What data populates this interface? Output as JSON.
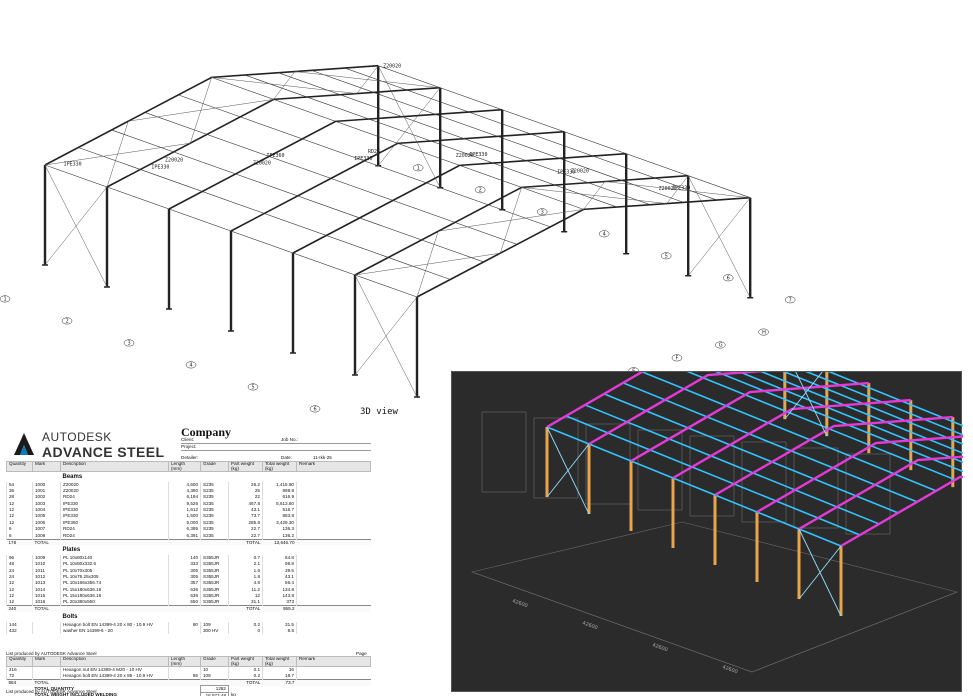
{
  "drawing": {
    "view_label": "3D view",
    "member_labels": [
      "IPE330",
      "Z20020",
      "IPE360",
      "RD24",
      "IPE330",
      "Z20020",
      "IPE330",
      "Z20020",
      "IPE330",
      "Z20020",
      "IPE330",
      "Z20020",
      "IPE330",
      "Z20020"
    ],
    "grid_markers": [
      "1",
      "2",
      "3",
      "4",
      "5",
      "6",
      "7",
      "A",
      "B",
      "C",
      "D",
      "E",
      "F",
      "G",
      "H",
      "1",
      "2",
      "3",
      "4",
      "5",
      "6",
      "7"
    ]
  },
  "bom": {
    "brand_line1": "AUTODESK",
    "brand_line2": "ADVANCE STEEL",
    "company": "Company",
    "client_label": "Client:",
    "job_label": "Job No.:",
    "project_label": "Project:",
    "detailer_label": "Detailer:",
    "date_label": "Date:",
    "date_value": "11-Ikk-25",
    "columns": [
      "Quantity",
      "Mark",
      "Description",
      "Length\n(mm)",
      "Grade",
      "Part weight\n(kg)",
      "Total weight\n(kg)",
      "Remark"
    ],
    "sections": [
      {
        "title": "Beams",
        "rows": [
          [
            "54",
            "1000",
            "Z20020",
            "4,600",
            "S235",
            "26.2",
            "1,415.90",
            ""
          ],
          [
            "36",
            "1001",
            "Z20020",
            "4,380",
            "S235",
            "25",
            "898.8",
            ""
          ],
          [
            "28",
            "1002",
            "RD24",
            "6,194",
            "S235",
            "22",
            "616.9",
            ""
          ],
          [
            "12",
            "1003",
            "IPE330",
            "9,526",
            "S235",
            "467.8",
            "5,613.60",
            ""
          ],
          [
            "12",
            "1004",
            "IPE330",
            "1,612",
            "S235",
            "43.1",
            "516.7",
            ""
          ],
          [
            "12",
            "1005",
            "IPE330",
            "1,500",
            "S235",
            "73.7",
            "883.8",
            ""
          ],
          [
            "12",
            "1006",
            "IPE360",
            "5,000",
            "S235",
            "285.8",
            "3,429.30",
            ""
          ],
          [
            "6",
            "1007",
            "RD24",
            "6,395",
            "S235",
            "22.7",
            "136.3",
            ""
          ],
          [
            "6",
            "1008",
            "RD24",
            "6,391",
            "S235",
            "22.7",
            "136.2",
            ""
          ]
        ],
        "total": [
          "178",
          "TOTAL",
          "",
          "",
          "",
          "TOTAL",
          "13,646.70",
          ""
        ]
      },
      {
        "title": "Plates",
        "rows": [
          [
            "96",
            "1009",
            "PL 10x80x140",
            "140",
            "S355JR",
            "0.7",
            "64.8",
            ""
          ],
          [
            "48",
            "1010",
            "PL 10x80x332.6",
            "333",
            "S355JR",
            "2.1",
            "98.8",
            ""
          ],
          [
            "24",
            "1011",
            "PL 10x70x305",
            "305",
            "S355JR",
            "1.6",
            "39.5",
            ""
          ],
          [
            "24",
            "1012",
            "PL 10x76.25x305",
            "305",
            "S355JR",
            "1.8",
            "43.1",
            ""
          ],
          [
            "12",
            "1013",
            "PL 10x166x356.74",
            "357",
            "S355JR",
            "4.8",
            "56.4",
            ""
          ],
          [
            "12",
            "1014",
            "PL 15x180x636.18",
            "636",
            "S355JR",
            "11.2",
            "134.8",
            ""
          ],
          [
            "12",
            "1015",
            "PL 15x180x636.18",
            "636",
            "S355JR",
            "12",
            "143.8",
            ""
          ],
          [
            "12",
            "1016",
            "PL 20x380x550",
            "550",
            "S355JR",
            "31.1",
            "373",
            ""
          ]
        ],
        "total": [
          "240",
          "TOTAL",
          "",
          "",
          "",
          "TOTAL",
          "955.2",
          ""
        ]
      },
      {
        "title": "Bolts",
        "rows": [
          [
            "144",
            "",
            "Hexagon bolt EN 14399-4 20 x 80 - 10.9 HV",
            "80",
            "109",
            "0.2",
            "31.5",
            ""
          ],
          [
            "432",
            "",
            "washer EN 14399-6 - 20",
            "",
            "300 HV",
            "0",
            "8.5",
            ""
          ]
        ],
        "total": null
      }
    ],
    "page_footer_1": "List produced by AUTODESK Advance Steel",
    "page_label": "Page",
    "rows2": [
      [
        "216",
        "",
        "Hexagon nut EN 14399-4 M20 - 10 HV",
        "",
        "10",
        "0.1",
        "16",
        ""
      ],
      [
        "72",
        "",
        "Hexagon bolt EN 14399-4 20 x 85 - 10.9 HV",
        "85",
        "109",
        "0.2",
        "18.7",
        ""
      ]
    ],
    "total2": [
      "864",
      "TOTAL",
      "",
      "",
      "",
      "TOTAL",
      "73.7",
      ""
    ],
    "total_quantity_label": "TOTAL QUANTITY",
    "total_quantity_value": "1282",
    "total_weight_label": "TOTAL WEIGHT INCLUDED WELDING",
    "total_weight_value": "16,873.48",
    "total_weight_unit": "kg",
    "page_footer_2": "List produced by AUTODESK Advance Steel"
  },
  "render": {
    "background": "#2b2b2b",
    "colors": {
      "purlins": "#33c4ff",
      "rafters": "#e23bd7",
      "columns": "#e8a54b",
      "bracing": "#8fe0ff"
    },
    "dim_labels": [
      "42600",
      "42600",
      "42600",
      "42600"
    ]
  }
}
